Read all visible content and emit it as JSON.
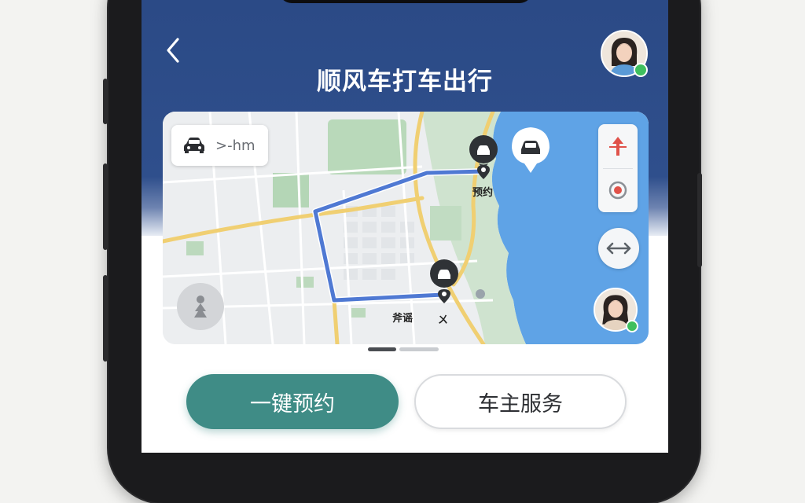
{
  "header": {
    "title": "顺风车打车出行"
  },
  "map": {
    "eta_chip": ">-hm",
    "labels": {
      "pickup": "预约",
      "start": "斧谣",
      "start_symbol": "ㄨ"
    }
  },
  "actions": {
    "primary_label": "一键预约",
    "secondary_label": "车主服务"
  },
  "colors": {
    "header_blue": "#2f4f8c",
    "primary_teal": "#3f8c86",
    "route_blue": "#4f79d3",
    "online_green": "#3fbf5e",
    "compass_red": "#e0524a"
  },
  "icons": {
    "back": "chevron-left-icon",
    "car": "car-icon",
    "compass": "compass-arrow-icon",
    "locate": "locate-icon",
    "swap": "swap-arrows-icon",
    "person": "person-silhouette-icon"
  }
}
